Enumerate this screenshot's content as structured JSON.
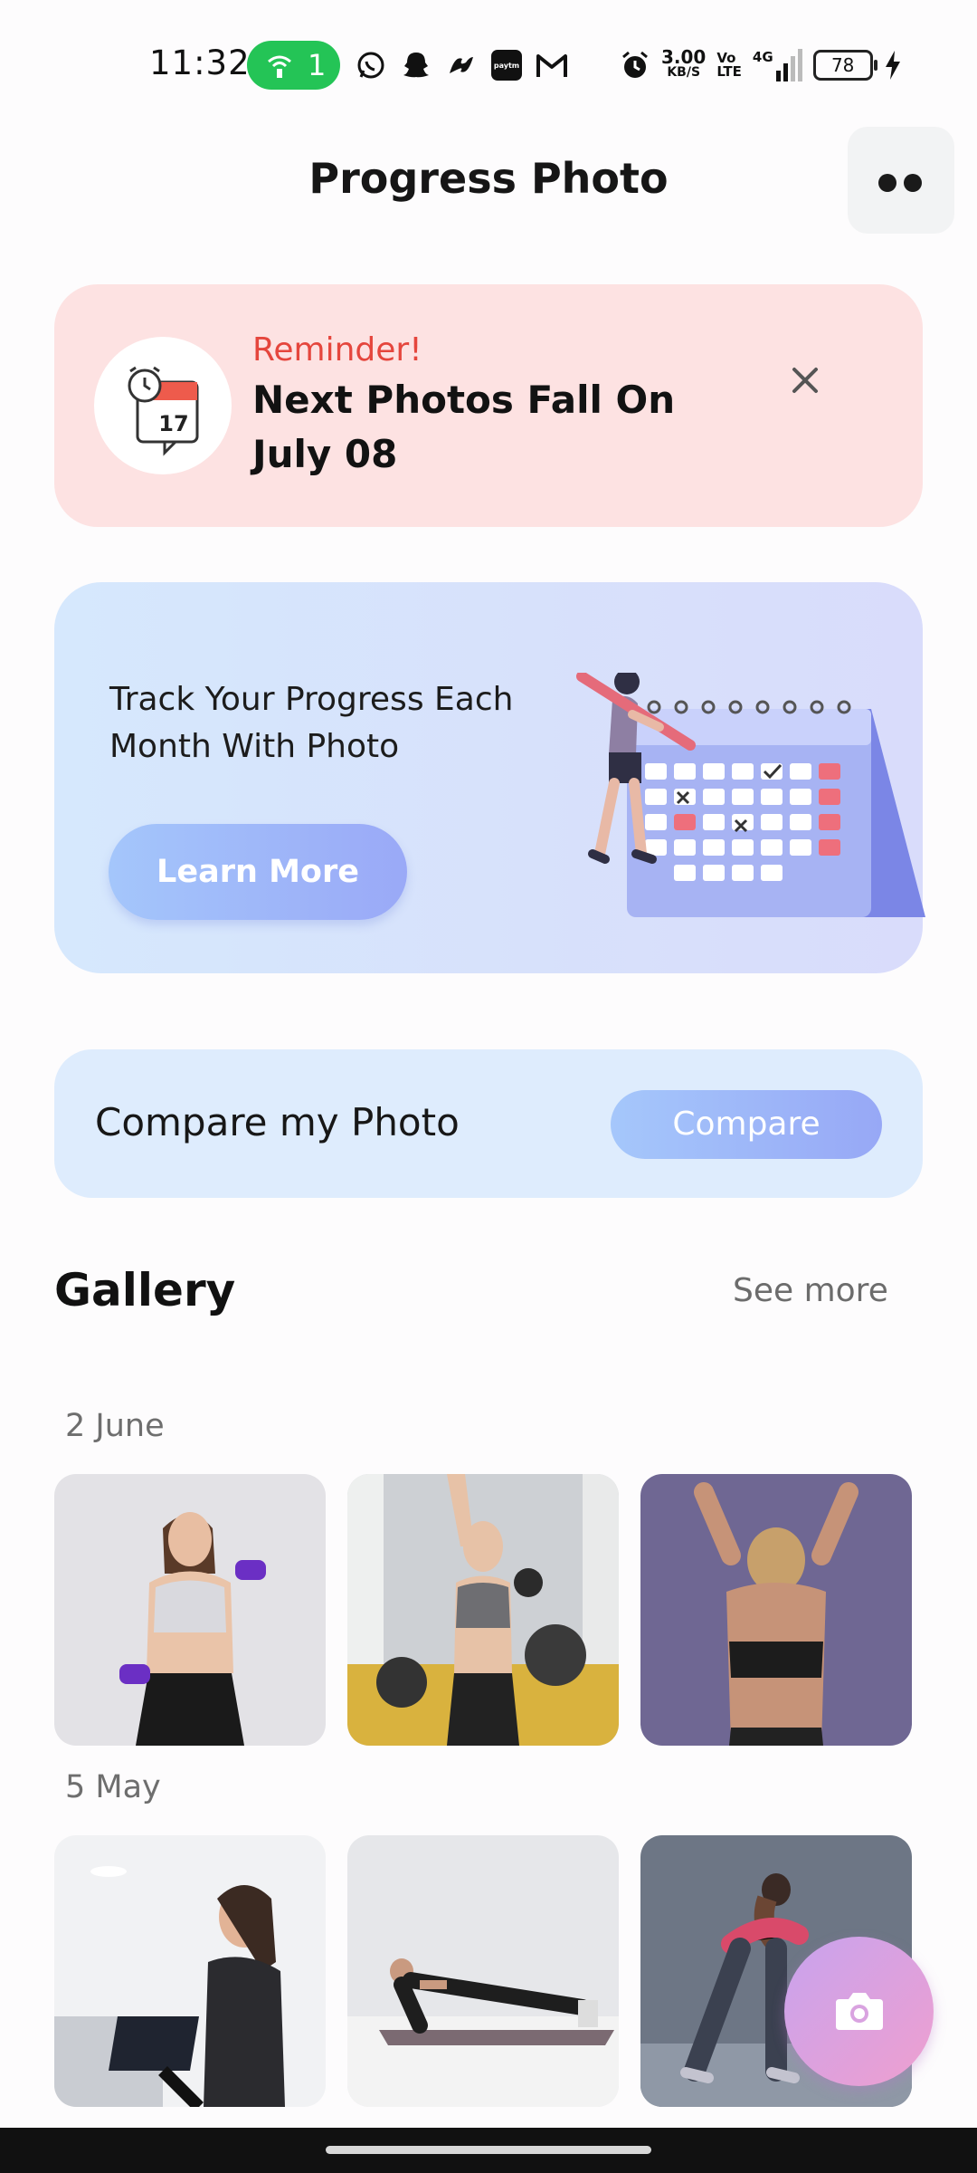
{
  "status_bar": {
    "time": "11:32",
    "hotspot_count": "1",
    "speed_value": "3.00",
    "speed_unit": "KB/S",
    "volte_top": "Vo",
    "volte_bottom": "LTE",
    "network": "4G",
    "battery": "78",
    "icons": [
      "whatsapp-icon",
      "snapchat-icon",
      "app-icon",
      "paytm-icon",
      "gmail-icon",
      "alarm-icon",
      "signal-icon",
      "charging-icon"
    ]
  },
  "header": {
    "title": "Progress Photo",
    "more_icon": "two-dots-menu-icon"
  },
  "reminder": {
    "label": "Reminder!",
    "text": "Next Photos Fall On July 08",
    "calendar_day": "17",
    "close_icon": "close-icon"
  },
  "banner": {
    "text": "Track Your Progress Each Month With Photo",
    "button_label": "Learn More"
  },
  "compare": {
    "label": "Compare my Photo",
    "button_label": "Compare"
  },
  "gallery": {
    "title": "Gallery",
    "see_more": "See more",
    "groups": [
      {
        "date": "2 June",
        "photos": [
          "woman-with-dumbbells-photo",
          "woman-lifting-dumbbell-gym-photo",
          "woman-back-view-photo"
        ]
      },
      {
        "date": "5 May",
        "photos": [
          "woman-on-exercise-bike-photo",
          "woman-plank-photo",
          "woman-stretching-photo"
        ]
      }
    ]
  },
  "fab": {
    "icon": "camera-icon"
  },
  "colors": {
    "reminder_bg": "#fde2e2",
    "reminder_accent": "#e5463d",
    "banner_bg": "#d7e4fc",
    "compare_bg": "#deecfd",
    "button_gradient_start": "#a4c6fb",
    "button_gradient_end": "#9aa9f7",
    "fab_gradient_start": "#c8a3ee",
    "fab_gradient_end": "#ef9fcf"
  }
}
